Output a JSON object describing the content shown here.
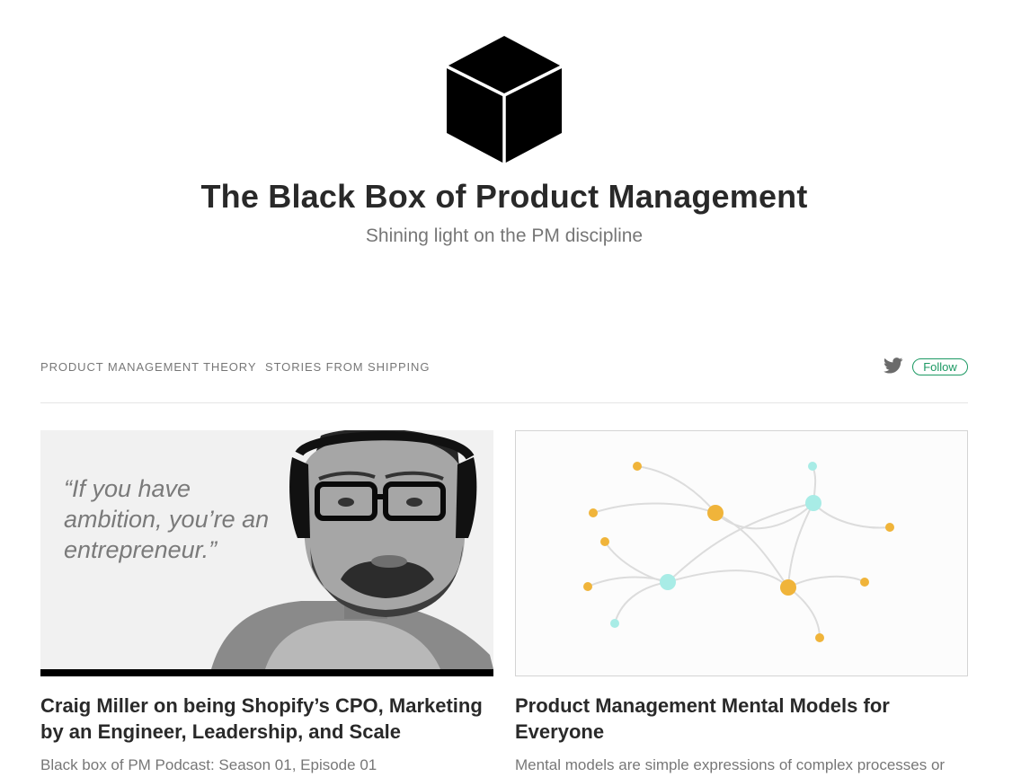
{
  "publication": {
    "title": "The Black Box of Product Management",
    "tagline": "Shining light on the PM discipline",
    "logo_icon": "black-cube-icon"
  },
  "nav": {
    "items": [
      {
        "label": "PRODUCT MANAGEMENT THEORY"
      },
      {
        "label": "STORIES FROM SHIPPING"
      }
    ],
    "twitter_icon": "twitter-bird-icon",
    "follow_label": "Follow"
  },
  "colors": {
    "accent_green": "#1c9963",
    "node_orange": "#f0b43a",
    "node_cyan": "#a8ece6"
  },
  "posts": [
    {
      "image_quote": "“If you have ambition, you’re an entrepreneur.”",
      "title": "Craig Miller on being Shopify’s CPO, Marketing by an Engineer, Leadership, and Scale",
      "subtitle": "Black box of PM Podcast: Season 01, Episode 01"
    },
    {
      "title": "Product Management Mental Models for Everyone",
      "subtitle": "Mental models are simple expressions of complex processes or"
    }
  ]
}
